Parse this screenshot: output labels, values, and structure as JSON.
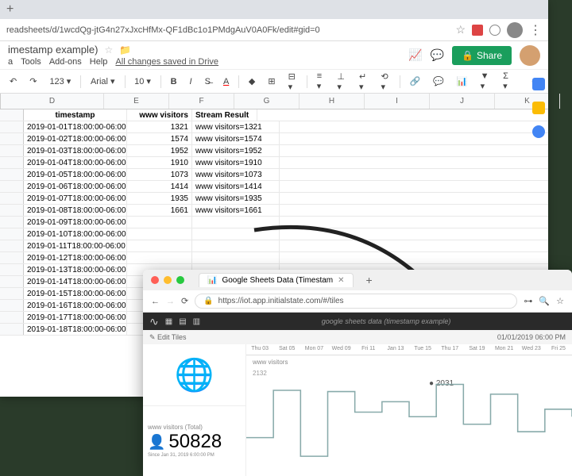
{
  "browser1": {
    "url": "readsheets/d/1wcdQg-jtG4n27xJxcHfMx-QF1dBc1o1PMdgAuV0A0Fk/edit#gid=0"
  },
  "sheets": {
    "title": "imestamp example)",
    "menu": {
      "a": "a",
      "tools": "Tools",
      "addons": "Add-ons",
      "help": "Help"
    },
    "saved": "All changes saved in Drive",
    "share": "Share",
    "zoom": "123",
    "font": "Arial",
    "size": "10"
  },
  "columns": [
    "D",
    "E",
    "F",
    "G",
    "H",
    "I",
    "J",
    "K"
  ],
  "headers": {
    "d": "timestamp",
    "e": "www visitors",
    "f": "Stream Result"
  },
  "rows": [
    {
      "d": "2019-01-01T18:00:00-06:00",
      "e": 1321,
      "f": "www visitors=1321"
    },
    {
      "d": "2019-01-02T18:00:00-06:00",
      "e": 1574,
      "f": "www visitors=1574"
    },
    {
      "d": "2019-01-03T18:00:00-06:00",
      "e": 1952,
      "f": "www visitors=1952"
    },
    {
      "d": "2019-01-04T18:00:00-06:00",
      "e": 1910,
      "f": "www visitors=1910"
    },
    {
      "d": "2019-01-05T18:00:00-06:00",
      "e": 1073,
      "f": "www visitors=1073"
    },
    {
      "d": "2019-01-06T18:00:00-06:00",
      "e": 1414,
      "f": "www visitors=1414"
    },
    {
      "d": "2019-01-07T18:00:00-06:00",
      "e": 1935,
      "f": "www visitors=1935"
    },
    {
      "d": "2019-01-08T18:00:00-06:00",
      "e": 1661,
      "f": "www visitors=1661"
    },
    {
      "d": "2019-01-09T18:00:00-06:00"
    },
    {
      "d": "2019-01-10T18:00:00-06:00"
    },
    {
      "d": "2019-01-11T18:00:00-06:00"
    },
    {
      "d": "2019-01-12T18:00:00-06:00"
    },
    {
      "d": "2019-01-13T18:00:00-06:00"
    },
    {
      "d": "2019-01-14T18:00:00-06:00"
    },
    {
      "d": "2019-01-15T18:00:00-06:00"
    },
    {
      "d": "2019-01-16T18:00:00-06:00"
    },
    {
      "d": "2019-01-17T18:00:00-06:00"
    },
    {
      "d": "2019-01-18T18:00:00-06:00"
    }
  ],
  "browser2": {
    "tab": "Google Sheets Data (Timestam",
    "url": "https://iot.app.initialstate.com/#/tiles"
  },
  "dashboard": {
    "title": "google sheets data (timestamp example)",
    "editTiles": "Edit Tiles",
    "date": "01/01/2019 06:00 PM",
    "timeline": [
      "Thu 03",
      "Sat 05",
      "Mon 07",
      "Wed 09",
      "Fri 11",
      "Jan 13",
      "Tue 15",
      "Thu 17",
      "Sat 19",
      "Mon 21",
      "Wed 23",
      "Fri 25"
    ],
    "series_label": "www visitors",
    "annotation_2031": "2031",
    "side_value": "2132",
    "total_label": "www visitors (Total)",
    "total_value": "50828",
    "total_since": "Since Jan 31, 2019 6:00:00 PM",
    "chart_data": {
      "type": "line-step",
      "x": [
        "Jan 01",
        "Jan 03",
        "Jan 05",
        "Jan 07",
        "Jan 09",
        "Jan 11",
        "Jan 13",
        "Jan 15",
        "Jan 17",
        "Jan 19",
        "Jan 21",
        "Jan 23",
        "Jan 25"
      ],
      "values": [
        1321,
        1952,
        1073,
        1935,
        1661,
        1800,
        1600,
        2031,
        1500,
        1900,
        1400,
        1700,
        1600
      ],
      "ylim": [
        900,
        2200
      ]
    }
  }
}
